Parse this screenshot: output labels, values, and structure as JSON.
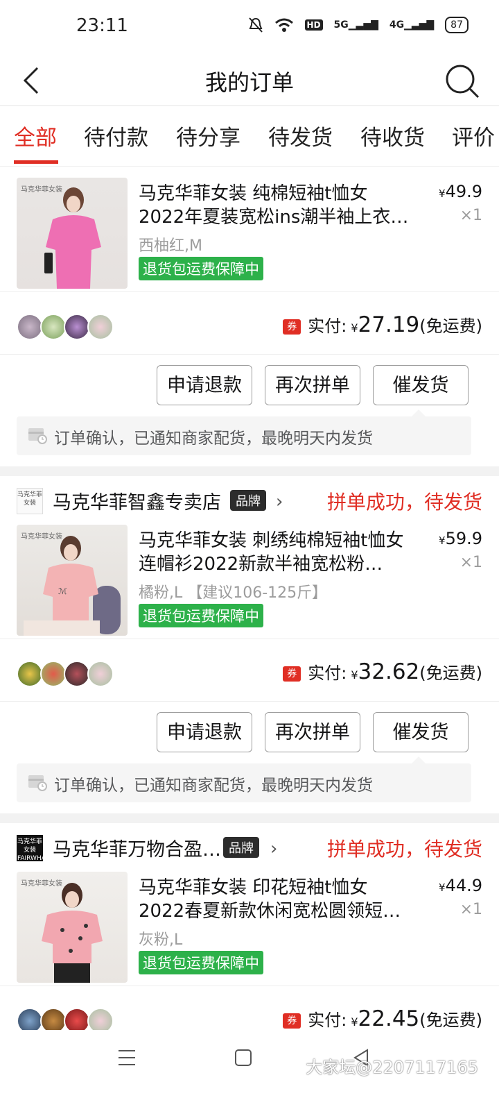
{
  "status_bar": {
    "time": "23:11",
    "signal_5g": "5G",
    "signal_4g": "4G",
    "hd": "HD",
    "battery": "87"
  },
  "header": {
    "title": "我的订单"
  },
  "tabs": [
    {
      "label": "全部",
      "active": true
    },
    {
      "label": "待付款"
    },
    {
      "label": "待分享"
    },
    {
      "label": "待发货"
    },
    {
      "label": "待收货"
    },
    {
      "label": "评价"
    }
  ],
  "orders": [
    {
      "shop": null,
      "item": {
        "thumb_tag": "马克华菲女装",
        "title": "马克华菲女装 纯棉短袖t恤女2022年夏装宽松ins潮半袖上衣…",
        "price_symbol": "¥",
        "price": "49.9",
        "qty": "×1",
        "spec": "西柚红,M",
        "guarantee": "退货包运费保障中"
      },
      "coupon_tag": "券",
      "paid_label": "实付:",
      "paid_symbol": "¥",
      "paid_amount": "27.19",
      "shipping_note": "(免运费)",
      "buttons": [
        "申请退款",
        "再次拼单",
        "催发货"
      ],
      "notice": "订单确认，已通知商家配货，最晚明天内发货"
    },
    {
      "shop": {
        "logo_text": "马克华菲女装",
        "name": "马克华菲智鑫专卖店",
        "badge": "品牌",
        "status": "拼单成功，待发货"
      },
      "item": {
        "thumb_tag": "马克华菲女装",
        "title": "马克华菲女装 刺绣纯棉短袖t恤女连帽衫2022新款半袖宽松粉…",
        "price_symbol": "¥",
        "price": "59.9",
        "qty": "×1",
        "spec": "橘粉,L 【建议106-125斤】",
        "guarantee": "退货包运费保障中"
      },
      "coupon_tag": "券",
      "paid_label": "实付:",
      "paid_symbol": "¥",
      "paid_amount": "32.62",
      "shipping_note": "(免运费)",
      "buttons": [
        "申请退款",
        "再次拼单",
        "催发货"
      ],
      "notice": "订单确认，已通知商家配货，最晚明天内发货"
    },
    {
      "shop": {
        "logo_text": "马克华菲女装 FAIRWHALE",
        "name": "马克华菲万物合盈…",
        "badge": "品牌",
        "status": "拼单成功，待发货"
      },
      "item": {
        "thumb_tag": "马克华菲女装",
        "title": "马克华菲女装 印花短袖t恤女2022春夏新款休闲宽松圆领短…",
        "price_symbol": "¥",
        "price": "44.9",
        "qty": "×1",
        "spec": "灰粉,L",
        "guarantee": "退货包运费保障中"
      },
      "coupon_tag": "券",
      "paid_label": "实付:",
      "paid_symbol": "¥",
      "paid_amount": "22.45",
      "shipping_note": "(免运费)"
    }
  ],
  "watermark": "大家坛@2207117165",
  "colors": {
    "accent": "#e02e24",
    "guarantee": "#2db14a",
    "brand_badge": "#2c2c2c"
  }
}
